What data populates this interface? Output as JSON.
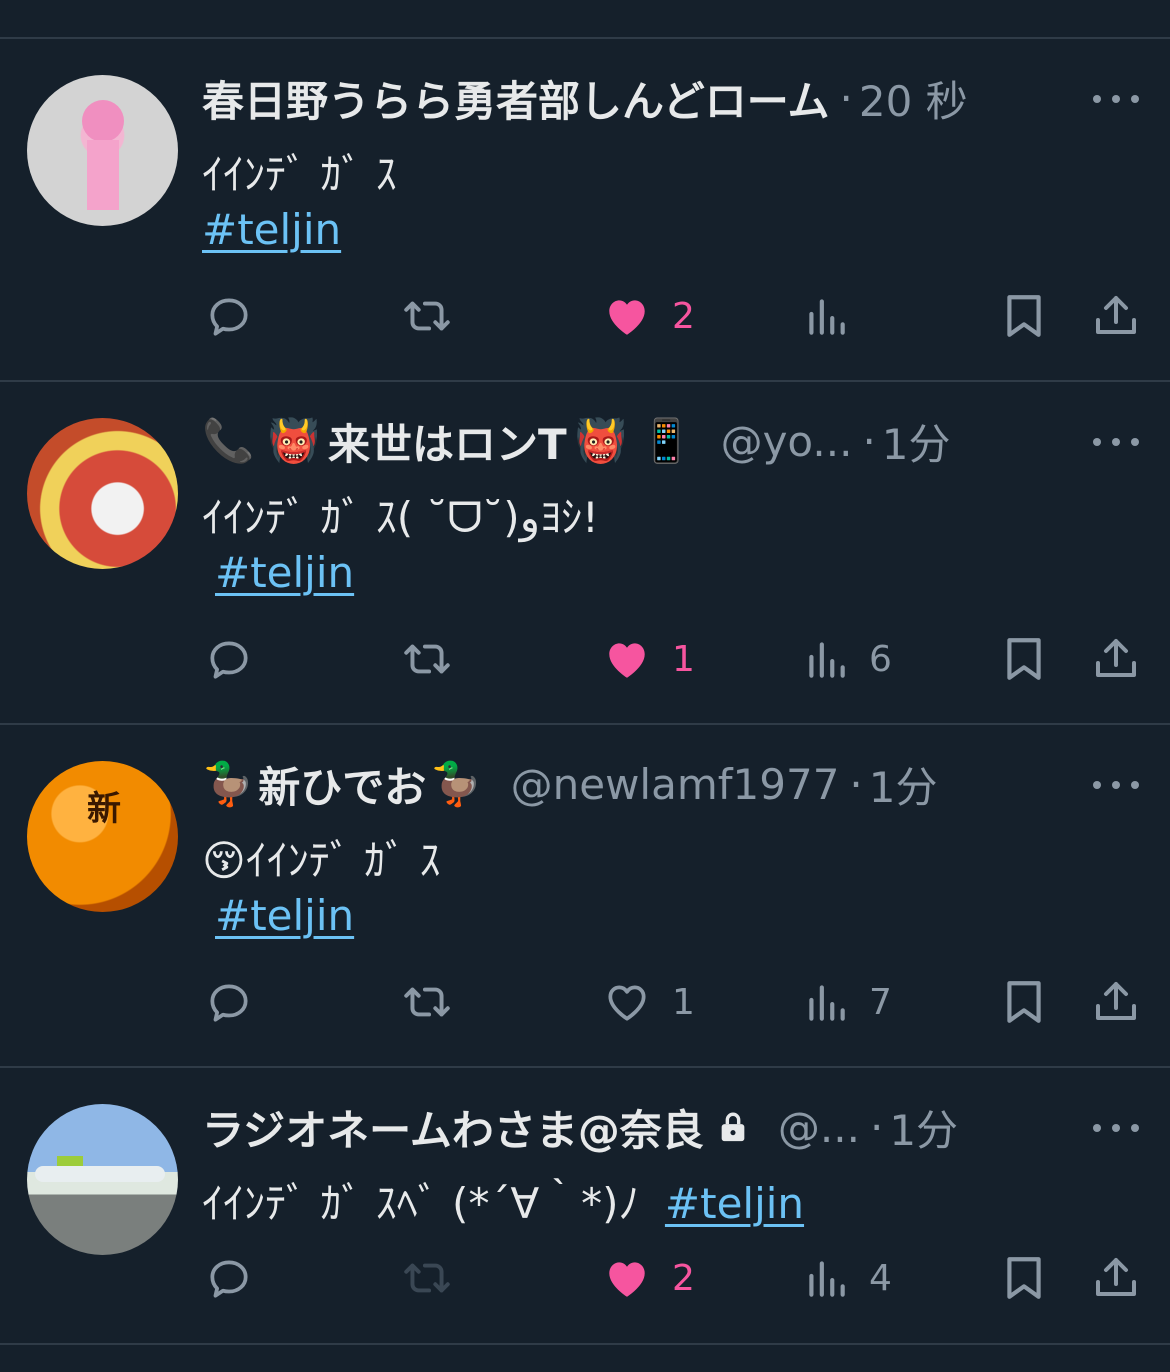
{
  "tweets": [
    {
      "name": "春日野うらら勇者部しんどローム",
      "handle": "",
      "time": "20 秒",
      "text": "ｲｲﾝﾃﾞ ｶﾞ ｽ",
      "hashtag": "#teljin",
      "likes": "2",
      "liked": true,
      "views": "",
      "retweet_enabled": true
    },
    {
      "name": "来世はロンT",
      "name_prefix_emoji": "📞 👹",
      "name_suffix_emoji": "👹 📱",
      "handle": "@yo...",
      "time": "1分",
      "text": "ｲｲﾝﾃﾞ ｶﾞ ｽ( ˘ᗜ˘)ﻭﾖｼ!",
      "hashtag": "#teljin",
      "likes": "1",
      "liked": true,
      "views": "6",
      "retweet_enabled": true
    },
    {
      "name": "新ひでお",
      "name_prefix_emoji": "🦆",
      "name_suffix_emoji": "🦆",
      "handle": "@newlamf1977",
      "time": "1分",
      "text_emoji": "😚",
      "text": "ｲｲﾝﾃﾞ ｶﾞ ｽ",
      "hashtag": "#teljin",
      "likes": "1",
      "liked": false,
      "views": "7",
      "retweet_enabled": true
    },
    {
      "name": "ラジオネームわさま@奈良",
      "handle": "@...",
      "time": "1分",
      "text": "ｲｲﾝﾃﾞ ｶﾞ ｽﾍﾞ (*´∀｀*)ﾉ",
      "hashtag": "#teljin",
      "likes": "2",
      "liked": true,
      "views": "4",
      "retweet_enabled": false,
      "protected": true
    }
  ],
  "avatar_badge": "新",
  "colors": {
    "background": "#15202b",
    "text": "#e7e9ea",
    "muted": "#8b98a5",
    "link": "#6cc2f5",
    "like": "#f6559f",
    "divider": "#2f3b47"
  },
  "icons": [
    "reply-icon",
    "retweet-icon",
    "heart-icon",
    "views-icon",
    "bookmark-icon",
    "share-icon",
    "more-icon",
    "lock-icon"
  ]
}
